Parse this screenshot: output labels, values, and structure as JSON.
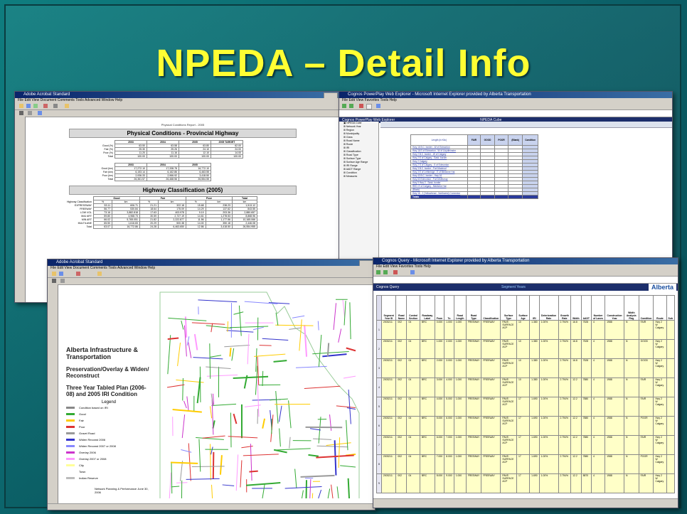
{
  "slide": {
    "title": "NPEDA – Detail Info"
  },
  "shot1": {
    "report_heading": "Physical Conditions Report - 2005",
    "section1_title": "Physical Conditions - Provincial Highway",
    "section2_title": "Highway Classification (2005)",
    "col_years": [
      "2003",
      "2004",
      "2005",
      "2005 TARGET"
    ],
    "rows_pct": [
      {
        "label": "Good (%)",
        "vals": [
          "63.50",
          "63.58",
          "63.80",
          "62.00"
        ]
      },
      {
        "label": "Fair (%)",
        "vals": [
          "25.30",
          "25.26",
          "24.10",
          "24.00"
        ]
      },
      {
        "label": "Poor (%)",
        "vals": [
          "11.20",
          "11.16",
          "12.10",
          "14.00"
        ]
      },
      {
        "label": "Total",
        "vals": [
          "100.00",
          "100.00",
          "100.00",
          "100.00"
        ]
      }
    ],
    "col_years2": [
      "2003",
      "2004",
      "2005"
    ],
    "rows_km": [
      {
        "label": "Good (km)",
        "vals": [
          "17,272.10",
          "17,338.78",
          "16,772.10"
        ]
      },
      {
        "label": "Fair (km)",
        "vals": [
          "6,153.14",
          "6,162.86",
          "6,463.55"
        ]
      },
      {
        "label": "Poor (km)",
        "vals": [
          "2,936.33",
          "2,966.92",
          "3,418.50"
        ]
      },
      {
        "label": "Total",
        "vals": [
          "26,361.57",
          "26,468.56",
          "26,554.55"
        ]
      }
    ],
    "class_groups": [
      "Good",
      "Fair",
      "Poor",
      "Total"
    ],
    "class_header": "Highway Classification",
    "class_rows": [
      {
        "label": "EXPRESSWAY",
        "vals": [
          "53.11",
          "606.71",
          "21.21",
          "322.18",
          "15.68",
          "238.23",
          "1,513.12"
        ]
      },
      {
        "label": "FREEWAY",
        "vals": [
          "56.77",
          "530.84",
          "18.64",
          "175.09",
          "14.29",
          "137.62",
          "843.55"
        ]
      },
      {
        "label": "LOW VOL",
        "vals": [
          "73.16",
          "3,882.818",
          "17.63",
          "403.978",
          "9.19",
          "203.36",
          "2,880.657"
        ]
      },
      {
        "label": "MAJ ART",
        "vals": [
          "59.80",
          "4,968.73",
          "30.59",
          "2,727.19",
          "14.61",
          "1,278.53",
          "8,868.96"
        ]
      },
      {
        "label": "MIN ART",
        "vals": [
          "66.02",
          "5,765.051",
          "21.82",
          "2,222.877",
          "11.56",
          "1,177.56",
          "10,165.066"
        ]
      },
      {
        "label": "MULTILANE",
        "vals": [
          "65.50",
          "1,616.83",
          "20.29",
          "500.38",
          "14.00",
          "350.18",
          "2,446.08"
        ]
      },
      {
        "label": "Total",
        "vals": [
          "63.07",
          "16,772.86",
          "24.28",
          "6,463.650",
          "12.86",
          "3,418.50",
          "26,554.955"
        ]
      }
    ]
  },
  "shot2": {
    "window_title": "Cognos PowerPlay Web Explorer - Microsoft Internet Explorer provided by Alberta Transportation",
    "app_header": "Cognos PowerPlay Web Explorer",
    "cube_name": "NPEDA Cube",
    "tree_items": [
      "NPEDA Cube",
      "Network Year",
      "Region",
      "Municipality",
      "Class",
      "Road Name",
      "Route",
      "IRI",
      "Classification",
      "Road Type",
      "Surface Type",
      "Surface Age Range",
      "IRI Range",
      "AADT Range",
      "Condition",
      "Measures"
    ],
    "row_header": "Length (in Kilo)",
    "col_headers": [
      "FAIR",
      "GOOD",
      "POOR",
      "(Blank)",
      "Condition"
    ],
    "row_labels": [
      "Hwy 16 B.C. border - W of Edmonton",
      "Hwy 16 E of Edmonton - W of Lloydminster",
      "Hwy 2 B.C. border - W of Calgary",
      "Hwy 2 E of Calgary - Sask. border",
      "Hwy 2 Calgary",
      "Hwy 2 S of Calgary - S of Edmonton",
      "Hwy 3 B.C. border - Fort Macleod",
      "Hwy 3 E of Lethbridge - E of Medicine Hat",
      "Hwy 43 B.C. border - Hwy 16",
      "Hwy 63 Edmonton - Fort McMurray",
      "Hwy 9 Hwy 2 - Sask. border",
      "RED: E of Calgary - Medicine Hat",
      "(Blank)",
      "Hwy 16 - 2 (Yellowhead - Northwest) Connector"
    ],
    "total_label": "Totals"
  },
  "shot3": {
    "org": "Alberta Infrastructure & Transportation",
    "subtitle1": "Preservation/Overlay & Widen/ Reconstruct",
    "subtitle2": "Three Year Tabled Plan (2006-08) and 2005 IRI Condition",
    "legend_title": "Legend",
    "legend_items": [
      {
        "label": "Condition based on IRI",
        "color": "#888888"
      },
      {
        "label": "Good",
        "color": "#33aa33"
      },
      {
        "label": "Fair",
        "color": "#ffcc00"
      },
      {
        "label": "Poor",
        "color": "#dd3333"
      },
      {
        "label": "Gravel Road",
        "color": "#999999"
      },
      {
        "label": "Widen Reconst 2006",
        "color": "#3333cc"
      },
      {
        "label": "Widen Reconst 2007 or 2008",
        "color": "#8888ff"
      },
      {
        "label": "Overlay 2006",
        "color": "#cc33cc"
      },
      {
        "label": "Overlay 2007 or 2008",
        "color": "#ff99ff"
      },
      {
        "label": "City",
        "color": "#ffff99"
      },
      {
        "label": "Town",
        "color": "#ffffff"
      },
      {
        "label": "Indian Reserve",
        "color": "#bbbbbb"
      }
    ],
    "footer": "Network Planning & Performance June 30, 2006"
  },
  "shot4": {
    "window_title": "Cognos Query - Microsoft Internet Explorer provided by Alberta Transportation",
    "app_header": "Cognos Query",
    "view_title": "Segment Years",
    "logo": "Alberta",
    "col_headers": [
      "Segment Year ID",
      "Road Name",
      "Control Section",
      "Roadway Label",
      "From",
      "To",
      "Road Length",
      "Road Type",
      "Classification",
      "Surface Type",
      "Surface Age",
      "IRI",
      "Deterioration Rate",
      "Growth Rate",
      "Width",
      "AADT",
      "Number of Lanes",
      "Construction Year",
      "Width Analysis Flag",
      "Condition",
      "Route",
      "Sub"
    ],
    "rows": [
      {
        "n": "1",
        "id": "2003211",
        "road": "002",
        "cs": "04",
        "rl": "BRC",
        "from": "0.000",
        "to": "1.000",
        "len": "1.000",
        "type": "FREEWAY",
        "surf": "PAVE: SURFACE ACP",
        "age": "10",
        "iri": "1.380",
        "det": "1.00%",
        "gr": "2.794%",
        "w": "16.8",
        "aadt": "7528",
        "lanes": "4",
        "cy": "1988",
        "wf": "N",
        "cond": "FAIR"
      },
      {
        "n": "2",
        "id": "2003211",
        "road": "002",
        "cs": "04",
        "rl": "BRC",
        "from": "1.000",
        "to": "2.000",
        "len": "1.000",
        "type": "FREEWAY",
        "surf": "PAVE: SURFACE ACP",
        "age": "10",
        "iri": "1.380",
        "det": "1.00%",
        "gr": "2.794%",
        "w": "16.8",
        "aadt": "7528",
        "lanes": "4",
        "cy": "1988",
        "wf": "N",
        "cond": "GOOD"
      },
      {
        "n": "3",
        "id": "2003211",
        "road": "002",
        "cs": "04",
        "rl": "BRC",
        "from": "2.000",
        "to": "3.000",
        "len": "1.000",
        "type": "FREEWAY",
        "surf": "PAVE: SURFACE ACP",
        "age": "10",
        "iri": "1.380",
        "det": "1.00%",
        "gr": "2.794%",
        "w": "16.8",
        "aadt": "7528",
        "lanes": "4",
        "cy": "1988",
        "wf": "N",
        "cond": "GOOD"
      },
      {
        "n": "4",
        "id": "2003211",
        "road": "002",
        "cs": "04",
        "rl": "BRC",
        "from": "3.000",
        "to": "4.000",
        "len": "1.000",
        "type": "FREEWAY",
        "surf": "PAVE: SURFACE ACP",
        "age": "10",
        "iri": "1.380",
        "det": "1.00%",
        "gr": "2.794%",
        "w": "12.2",
        "aadt": "7880",
        "lanes": "4",
        "cy": "1988",
        "wf": "N",
        "cond": "FAIR"
      },
      {
        "n": "5",
        "id": "2003211",
        "road": "002",
        "cs": "04",
        "rl": "BRC",
        "from": "4.000",
        "to": "5.000",
        "len": "1.000",
        "type": "FREEWAY",
        "surf": "PAVE: SURFACE ACP",
        "age": "17",
        "iri": "1.690",
        "det": "1.00%",
        "gr": "2.794%",
        "w": "12.2",
        "aadt": "7880",
        "lanes": "4",
        "cy": "1988",
        "wf": "N",
        "cond": "FAIR"
      },
      {
        "n": "6",
        "id": "2003211",
        "road": "002",
        "cs": "04",
        "rl": "BRC",
        "from": "5.000",
        "to": "6.000",
        "len": "1.000",
        "type": "FREEWAY",
        "surf": "PAVE: SURFACE ACP",
        "age": "17",
        "iri": "1.690",
        "det": "1.00%",
        "gr": "2.794%",
        "w": "12.2",
        "aadt": "7880",
        "lanes": "4",
        "cy": "1988",
        "wf": "N",
        "cond": "POOR"
      },
      {
        "n": "7",
        "id": "2003211",
        "road": "002",
        "cs": "04",
        "rl": "BRC",
        "from": "6.000",
        "to": "7.000",
        "len": "1.000",
        "type": "FREEWAY",
        "surf": "PAVE: SURFACE ACP",
        "age": "17",
        "iri": "1.690",
        "det": "1.00%",
        "gr": "2.794%",
        "w": "12.2",
        "aadt": "7880",
        "lanes": "4",
        "cy": "1988",
        "wf": "N",
        "cond": "FAIR"
      },
      {
        "n": "8",
        "id": "2003211",
        "road": "002",
        "cs": "04",
        "rl": "BRC",
        "from": "7.000",
        "to": "8.000",
        "len": "1.000",
        "type": "FREEWAY",
        "surf": "PAVE: SURFACE ACP",
        "age": "17",
        "iri": "1.690",
        "det": "1.00%",
        "gr": "2.794%",
        "w": "12.2",
        "aadt": "7880",
        "lanes": "4",
        "cy": "1988",
        "wf": "N",
        "cond": "POOR"
      },
      {
        "n": "9",
        "id": "2003211",
        "road": "002",
        "cs": "04",
        "rl": "BRC",
        "from": "8.000",
        "to": "9.000",
        "len": "1.000",
        "type": "FREEWAY",
        "surf": "PAVE: SURFACE ACP",
        "age": "17",
        "iri": "1.690",
        "det": "1.00%",
        "gr": "2.794%",
        "w": "12.2",
        "aadt": "8870",
        "lanes": "4",
        "cy": "1988",
        "wf": "N",
        "cond": "FAIR"
      }
    ]
  }
}
